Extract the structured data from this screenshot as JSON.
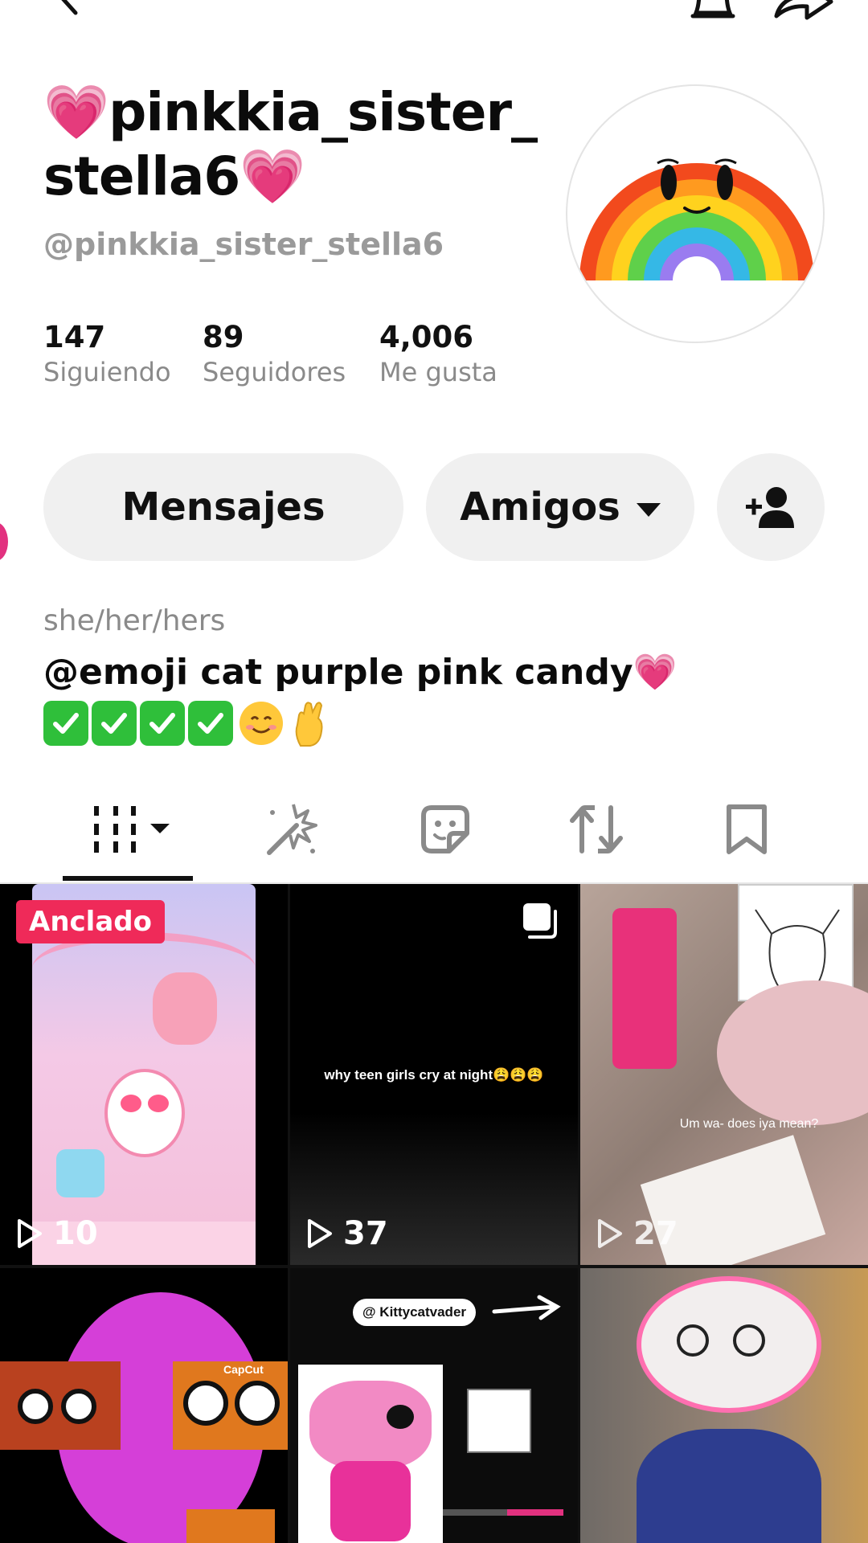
{
  "header": {
    "display_name_line1": "💗pinkkia_sister_",
    "display_name_line2": "stella6💗",
    "username": "@pinkkia_sister_stella6"
  },
  "stats": [
    {
      "value": "147",
      "label": "Siguiendo"
    },
    {
      "value": "89",
      "label": "Seguidores"
    },
    {
      "value": "4,006",
      "label": "Me gusta"
    }
  ],
  "actions": {
    "messages_label": "Mensajes",
    "friends_label": "Amigos"
  },
  "bio": {
    "pronouns": "she/her/hers",
    "line1": "@emoji cat purple pink candy",
    "heart": "💗"
  },
  "tabs": [
    {
      "icon": "videos-grid-icon",
      "selected": true
    },
    {
      "icon": "sparkle-wand-icon",
      "selected": false
    },
    {
      "icon": "sticker-face-icon",
      "selected": false
    },
    {
      "icon": "repost-icon",
      "selected": false
    },
    {
      "icon": "bookmark-icon",
      "selected": false
    }
  ],
  "videos": [
    {
      "pinned_label": "Anclado",
      "views": "10"
    },
    {
      "caption": "why teen girls cry at night😩😩😩",
      "views": "37"
    },
    {
      "caption": "Um wa- does iya mean?",
      "views": "27"
    },
    {
      "watermark": "CapCut"
    },
    {
      "tag": "@ Kittycatvader"
    },
    {}
  ],
  "colors": {
    "accent_pinned": "#ef2a59",
    "button_bg": "#f0f0f0",
    "muted_text": "#8a8a8a"
  }
}
